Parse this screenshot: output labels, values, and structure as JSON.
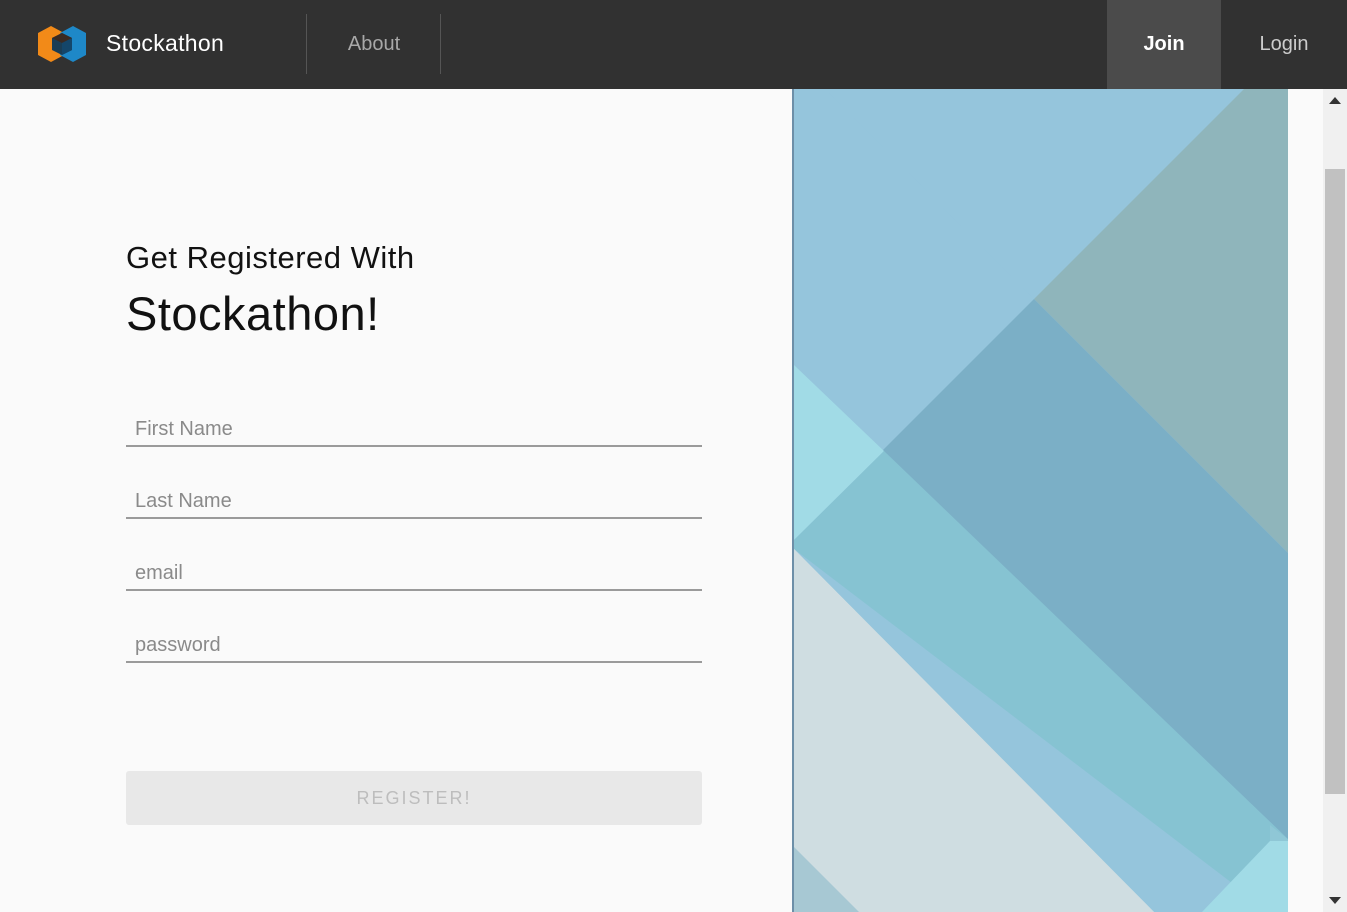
{
  "app": {
    "brand": "Stockathon",
    "logo_icon": "stockathon-hexagon-logo-icon",
    "colors": {
      "header_bg": "#313131",
      "logo_orange": "#f28a18",
      "logo_blue": "#1e88c8",
      "logo_dark": "#1a4e73"
    }
  },
  "nav": {
    "about": "About",
    "join": "Join",
    "login": "Login"
  },
  "form": {
    "heading_line1": "Get Registered With",
    "heading_line2": "Stockathon!",
    "first_name": {
      "value": "",
      "placeholder": "First Name"
    },
    "last_name": {
      "value": "",
      "placeholder": "Last Name"
    },
    "email": {
      "value": "",
      "placeholder": "email"
    },
    "password": {
      "value": "",
      "placeholder": "password"
    },
    "submit_label": "REGISTER!"
  },
  "art_panel": {
    "icon": "geometric-diagonal-pattern",
    "colors": [
      "#95c5dc",
      "#8fb5bb",
      "#7bafc6",
      "#a1dbe6",
      "#86c3d2",
      "#ceddE1"
    ]
  }
}
